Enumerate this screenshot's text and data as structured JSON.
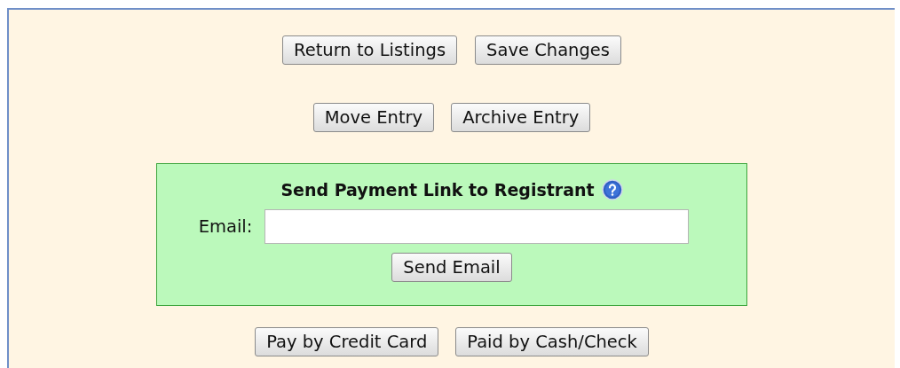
{
  "top_buttons": [
    "Return to Listings",
    "Save Changes"
  ],
  "entry_buttons": [
    "Move Entry",
    "Archive Entry"
  ],
  "payment_link": {
    "title": "Send Payment Link to Registrant",
    "email_label": "Email:",
    "send_button": "Send Email"
  },
  "payment_buttons": [
    "Pay by Credit Card",
    "Paid by Cash/Check"
  ]
}
